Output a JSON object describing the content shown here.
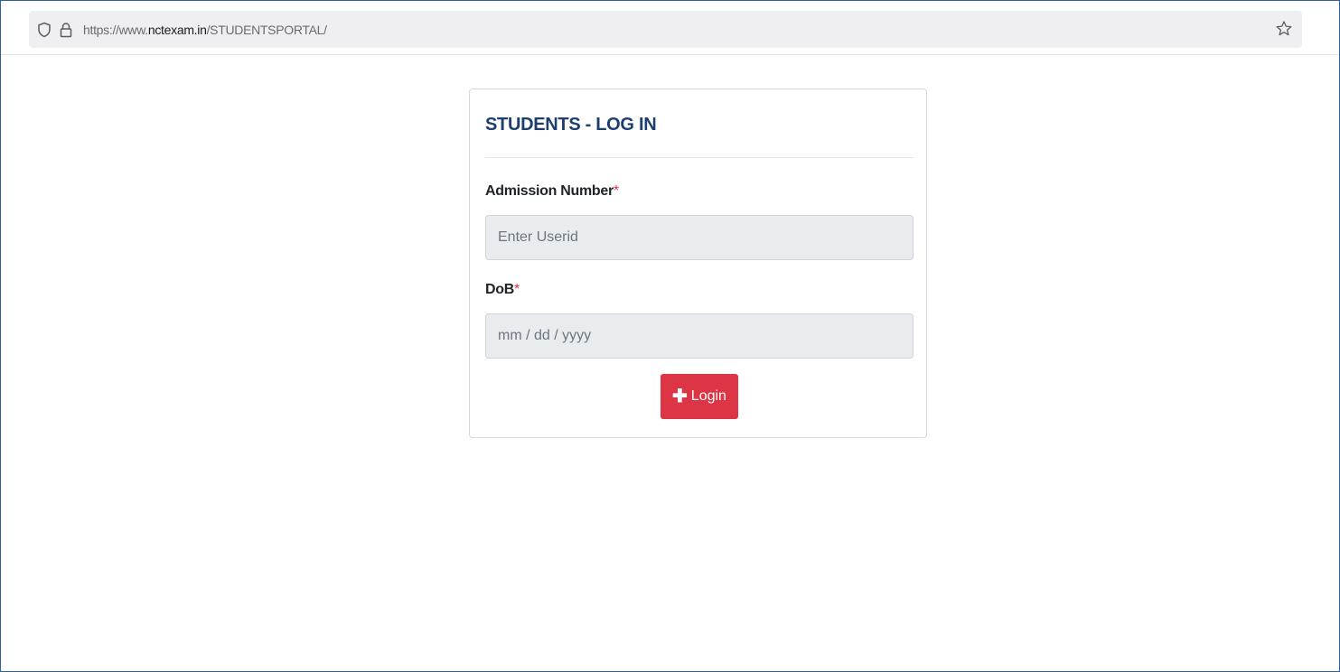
{
  "browser": {
    "url_prefix": "https://www.",
    "url_domain": "nctexam.in",
    "url_path": "/STUDENTSPORTAL/"
  },
  "login": {
    "title": "STUDENTS - LOG IN",
    "admission_label": "Admission Number",
    "required_mark": "*",
    "admission_placeholder": "Enter Userid",
    "dob_label": "DoB",
    "dob_placeholder": "mm / dd / yyyy",
    "button_icon": "plus-icon",
    "button_label": "Login"
  },
  "colors": {
    "accent": "#dc3545",
    "title": "#1d3f6e",
    "input_bg": "#e9ecef"
  }
}
